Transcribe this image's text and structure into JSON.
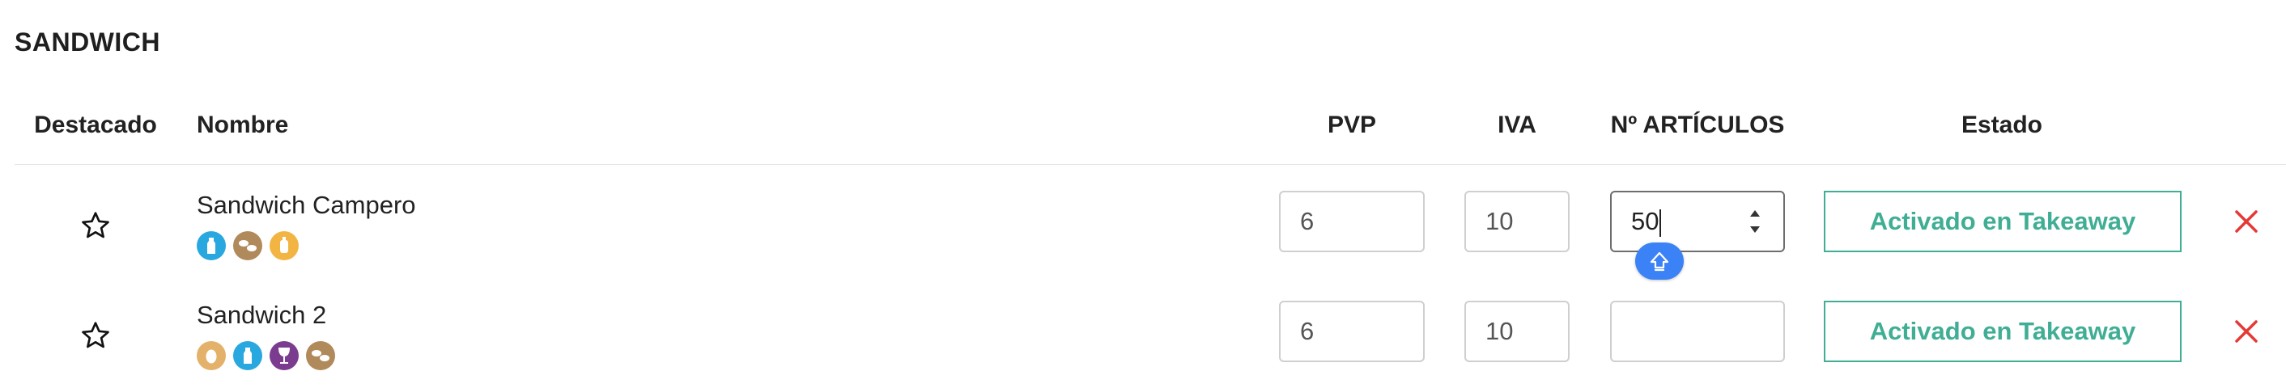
{
  "section": {
    "title": "SANDWICH"
  },
  "table": {
    "headers": {
      "destacado": "Destacado",
      "nombre": "Nombre",
      "pvp": "PVP",
      "iva": "IVA",
      "articulos": "Nº ARTÍCULOS",
      "estado": "Estado"
    },
    "rows": [
      {
        "name": "Sandwich Campero",
        "pvp": "6",
        "iva": "10",
        "articulos": "50",
        "status": "Activado en Takeaway",
        "allergens": [
          "bottle-icon",
          "mollusc-icon",
          "mustard-icon"
        ]
      },
      {
        "name": "Sandwich 2",
        "pvp": "6",
        "iva": "10",
        "articulos": "",
        "status": "Activado en Takeaway",
        "allergens": [
          "egg-icon",
          "bottle-icon",
          "sulphite-wine-icon",
          "mollusc-icon"
        ]
      }
    ]
  },
  "colors": {
    "accent": "#3fae94",
    "delete": "#e53935",
    "floating": "#3b82f6"
  }
}
